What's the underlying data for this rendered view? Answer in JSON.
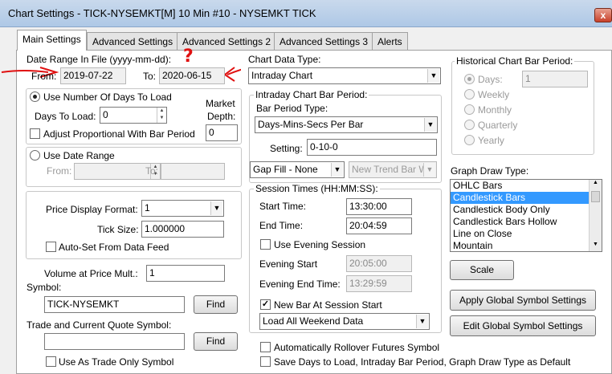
{
  "window": {
    "title": "Chart Settings - TICK-NYSEMKT[M]  10 Min   #10 - NYSEMKT TICK",
    "close_glyph": "x"
  },
  "tabs": [
    {
      "label": "Main Settings"
    },
    {
      "label": "Advanced Settings"
    },
    {
      "label": "Advanced Settings 2"
    },
    {
      "label": "Advanced Settings 3"
    },
    {
      "label": "Alerts"
    }
  ],
  "annotation": {
    "question": "?"
  },
  "date_range": {
    "label": "Date Range In File (yyyy-mm-dd):",
    "from_label": "From:",
    "from_value": "2019-07-22",
    "to_label": "To:",
    "to_value": "2020-06-15"
  },
  "days_group": {
    "radio_label": "Use Number Of Days To Load",
    "days_to_load_label": "Days To Load:",
    "days_to_load_value": "0",
    "market_depth_label_1": "Market",
    "market_depth_label_2": "Depth:",
    "market_depth_value": "0",
    "adjust_label": "Adjust Proportional With Bar Period"
  },
  "date_range_group": {
    "radio_label": "Use Date Range",
    "from_label": "From:",
    "to_label": "To:"
  },
  "price_group": {
    "format_label": "Price Display Format:",
    "format_value": "1",
    "tick_size_label": "Tick Size:",
    "tick_size_value": "1.000000",
    "auto_set_label": "Auto-Set From Data Feed"
  },
  "volume": {
    "label": "Volume at Price Mult.:",
    "value": "1"
  },
  "symbol": {
    "label": "Symbol:",
    "value": "TICK-NYSEMKT",
    "find_label": "Find"
  },
  "trade_symbol": {
    "label": "Trade and Current Quote Symbol:",
    "value": "",
    "find_label": "Find",
    "trade_only_label": "Use As Trade Only Symbol"
  },
  "chart_data_type": {
    "label": "Chart Data Type:",
    "value": "Intraday Chart"
  },
  "intraday_bar_period": {
    "legend": "Intraday Chart Bar Period:",
    "type_label": "Bar Period Type:",
    "type_value": "Days-Mins-Secs Per Bar",
    "setting_label": "Setting:",
    "setting_value": "0-10-0",
    "gap_fill_value": "Gap Fill - None",
    "new_trend_value": "New Trend Bar W"
  },
  "session_times": {
    "legend": "Session Times (HH:MM:SS):",
    "start_label": "Start Time:",
    "start_value": "13:30:00",
    "end_label": "End Time:",
    "end_value": "20:04:59",
    "evening_session_label": "Use Evening Session",
    "evening_start_label": "Evening Start",
    "evening_start_value": "20:05:00",
    "evening_end_label": "Evening End Time:",
    "evening_end_value": "13:29:59",
    "new_bar_label": "New Bar At Session Start",
    "weekend_value": "Load All Weekend Data"
  },
  "historical": {
    "legend": "Historical Chart Bar Period:",
    "options": [
      "Days:",
      "Weekly",
      "Monthly",
      "Quarterly",
      "Yearly"
    ],
    "days_value": "1"
  },
  "graph_draw": {
    "label": "Graph Draw Type:",
    "items": [
      "OHLC Bars",
      "Candlestick Bars",
      "Candlestick Body Only",
      "Candlestick Bars Hollow",
      "Line on Close",
      "Mountain"
    ],
    "selected": "Candlestick Bars"
  },
  "buttons": {
    "scale": "Scale",
    "apply_global": "Apply Global Symbol Settings",
    "edit_global": "Edit Global Symbol Settings"
  },
  "bottom": {
    "rollover_label": "Automatically Rollover Futures Symbol",
    "save_default_label": "Save Days to Load, Intraday Bar Period, Graph Draw Type as Default"
  },
  "glyphs": {
    "check": "✓",
    "down": "▼",
    "up_small": "▲",
    "down_small": "▼"
  },
  "colors": {
    "annotation": "#e01010",
    "selection": "#3399ff"
  }
}
